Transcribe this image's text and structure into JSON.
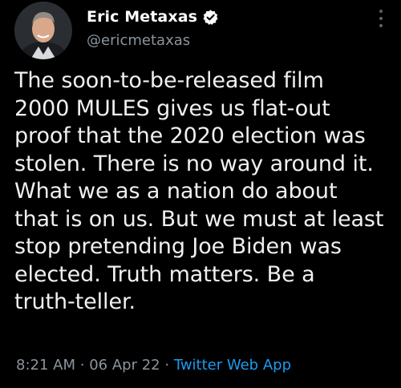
{
  "author": {
    "display_name": "Eric Metaxas",
    "handle": "@ericmetaxas",
    "verified": true
  },
  "icons": {
    "verified": "verified-badge-icon",
    "more": "more-vertical-icon"
  },
  "tweet": {
    "text": "The soon-to-be-released film\n2000 MULES gives us flat-out\nproof that the 2020 election was\nstolen. There is no way around it.\nWhat we as a nation do about\nthat is on us. But we must at least\nstop pretending Joe Biden was\nelected. Truth matters. Be a\ntruth-teller.",
    "time": "8:21 AM",
    "separator": "·",
    "date": "06 Apr 22",
    "source": "Twitter Web App"
  },
  "colors": {
    "background": "#000000",
    "text": "#e7e9ea",
    "muted": "#8b949c",
    "link": "#1d9bf0"
  }
}
